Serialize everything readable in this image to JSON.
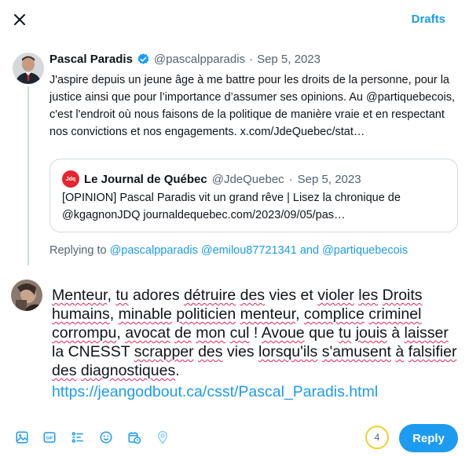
{
  "header": {
    "drafts_label": "Drafts"
  },
  "post": {
    "author_name": "Pascal Paradis",
    "handle": "@pascalpparadis",
    "separator": "·",
    "date": "Sep 5, 2023",
    "text": "J'aspire depuis un jeune âge à me battre pour les droits de la personne, pour la justice ainsi que pour l’importance d’assumer ses opinions. Au @partiquebecois, c'est l'endroit où nous faisons de la politique de manière vraie et en respectant nos convictions et nos engagements. x.com/JdeQuebec/stat…"
  },
  "quote": {
    "logo_text": "Jdq",
    "name": "Le Journal de Québec",
    "handle": "@JdeQuebec",
    "separator": "·",
    "date": "Sep 5, 2023",
    "text": "[OPINION] Pascal Paradis vit un grand rêve | Lisez la chronique de @kgagnonJDQ  journaldequebec.com/2023/09/05/pas…"
  },
  "replying": {
    "prefix": "Replying to",
    "mentions": "@pascalpparadis @emilou87721341",
    "and": "and",
    "last_mention": "@partiquebecois"
  },
  "compose": {
    "segments": [
      {
        "t": "Menteur",
        "sq": true
      },
      {
        "t": ", "
      },
      {
        "t": "tu",
        "sq": true
      },
      {
        "t": " adores "
      },
      {
        "t": "détruire",
        "sq": true
      },
      {
        "t": " "
      },
      {
        "t": "des",
        "sq": true
      },
      {
        "t": " vies et "
      },
      {
        "t": "violer",
        "sq": true
      },
      {
        "t": " "
      },
      {
        "t": "les",
        "sq": true
      },
      {
        "t": " "
      },
      {
        "t": "Droits",
        "sq": true
      },
      {
        "t": " "
      },
      {
        "t": "humains",
        "sq": true
      },
      {
        "t": ", "
      },
      {
        "t": "minable",
        "sq": true
      },
      {
        "t": " "
      },
      {
        "t": "politicien",
        "sq": true
      },
      {
        "t": " "
      },
      {
        "t": "menteur",
        "sq": true
      },
      {
        "t": ", "
      },
      {
        "t": "complice",
        "sq": true
      },
      {
        "t": " "
      },
      {
        "t": "criminel",
        "sq": true
      },
      {
        "t": " "
      },
      {
        "t": "corrompu",
        "sq": true
      },
      {
        "t": ", "
      },
      {
        "t": "avocat",
        "sq": true
      },
      {
        "t": " "
      },
      {
        "t": "de",
        "sq": true
      },
      {
        "t": " "
      },
      {
        "t": "mon",
        "sq": true
      },
      {
        "t": " "
      },
      {
        "t": "cul",
        "sq": true
      },
      {
        "t": " !  "
      },
      {
        "t": "Avoue",
        "sq": true
      },
      {
        "t": " que "
      },
      {
        "t": "tu",
        "sq": true
      },
      {
        "t": " "
      },
      {
        "t": "jouis",
        "sq": true
      },
      {
        "t": " à "
      },
      {
        "t": "laisser",
        "sq": true
      },
      {
        "t": " la CNESST "
      },
      {
        "t": "scrapper",
        "sq": true
      },
      {
        "t": " "
      },
      {
        "t": "des",
        "sq": true
      },
      {
        "t": " vies "
      },
      {
        "t": "lorsqu'ils",
        "sq": true
      },
      {
        "t": " "
      },
      {
        "t": "s'amusent",
        "sq": true
      },
      {
        "t": " "
      },
      {
        "t": "à",
        "sq": true
      },
      {
        "t": " "
      },
      {
        "t": "falsifier",
        "sq": true
      },
      {
        "t": " "
      },
      {
        "t": "des",
        "sq": true
      },
      {
        "t": " "
      },
      {
        "t": "diagnostiques",
        "sq": true
      },
      {
        "t": "."
      }
    ],
    "link": "https://jeangodbout.ca/csst/Pascal_Paradis.html"
  },
  "toolbar": {
    "icons": [
      "image-icon",
      "gif-icon",
      "poll-icon",
      "emoji-icon",
      "schedule-icon",
      "location-icon"
    ],
    "char_counter": "4",
    "reply_label": "Reply"
  },
  "colors": {
    "accent": "#1d9bf0",
    "text": "#0f1419",
    "muted": "#536471",
    "counter_ring": "#f0d030"
  }
}
